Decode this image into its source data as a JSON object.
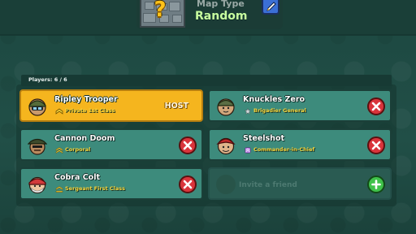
{
  "map": {
    "type_label": "Map Type",
    "type_value": "Random",
    "thumb_icon": "question-mark-icon",
    "unknown_glyph": "?"
  },
  "lobby": {
    "players_count": "Players: 6 / 6",
    "invite_label": "Invite a friend",
    "players": [
      {
        "name": "Ripley Trooper",
        "rank": "Private 1st Class",
        "rank_icon": "private-rank-icon",
        "badge": "HOST",
        "is_host": true
      },
      {
        "name": "Knuckles Zero",
        "rank": "Brigadier General",
        "rank_icon": "star-rank-icon",
        "is_host": false
      },
      {
        "name": "Cannon Doom",
        "rank": "Corporal",
        "rank_icon": "corporal-rank-icon",
        "is_host": false
      },
      {
        "name": "Steelshot",
        "rank": "Commander-in-Chief",
        "rank_icon": "commander-rank-icon",
        "is_host": false
      },
      {
        "name": "Cobra Colt",
        "rank": "Sergeant First Class",
        "rank_icon": "sergeant-rank-icon",
        "is_host": false
      }
    ]
  },
  "colors": {
    "background": "#1e4a42",
    "card": "#3d8b7c",
    "host_card": "#f5b51e",
    "kick": "#d9343b",
    "add": "#3fc24a",
    "rank_text": "#f5d23a",
    "map_value": "#c8ffa0"
  }
}
